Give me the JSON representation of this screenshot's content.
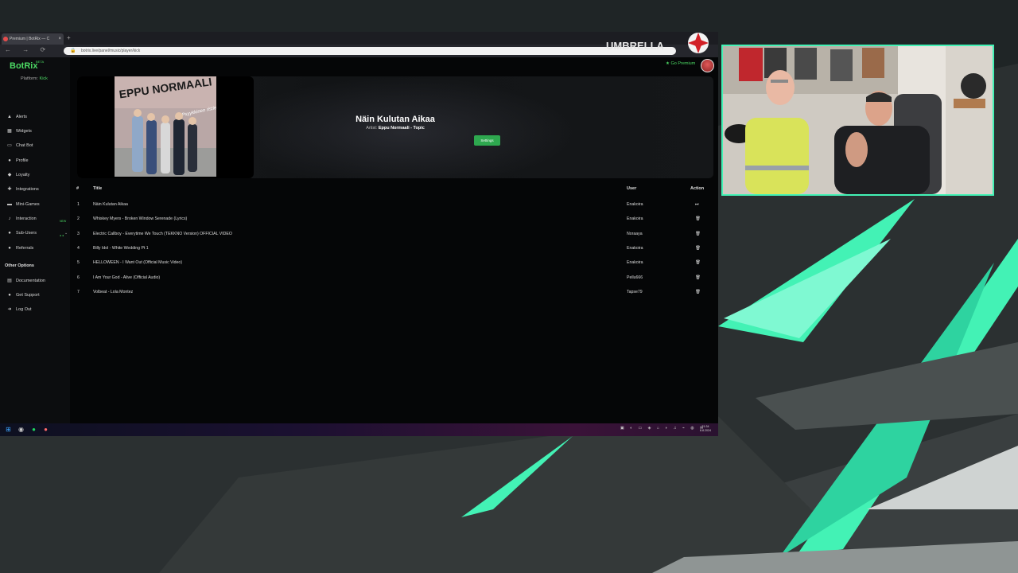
{
  "browser": {
    "tab_title": "Premium | BotRix — C",
    "tab_close": "×",
    "new_tab": "+",
    "nav_buttons": "← → ⟳",
    "url": "botrix.live/panel/music/player/kick"
  },
  "app": {
    "logo": "BotRix",
    "logo_badge": "BETA",
    "platform_label": "Platform:",
    "platform_value": "Kick",
    "go_premium": "★ Go Premium"
  },
  "sidebar": {
    "items": [
      {
        "label": "Alerts",
        "icon": "bell-icon",
        "glyph": "▲"
      },
      {
        "label": "Widgets",
        "icon": "widgets-icon",
        "glyph": "▦"
      },
      {
        "label": "Chat Bot",
        "icon": "chat-icon",
        "glyph": "▭"
      },
      {
        "label": "Profile",
        "icon": "user-icon",
        "glyph": "●"
      },
      {
        "label": "Loyalty",
        "icon": "gift-icon",
        "glyph": "◆"
      },
      {
        "label": "Integrations",
        "icon": "puzzle-icon",
        "glyph": "✚"
      },
      {
        "label": "Mini-Games",
        "icon": "gamepad-icon",
        "glyph": "▬"
      },
      {
        "label": "Interaction",
        "icon": "music-icon",
        "glyph": "♪",
        "badge": "NEW"
      },
      {
        "label": "Sub-Users",
        "icon": "users-icon",
        "glyph": "●",
        "badge": "● ●",
        "chevron": "⌄"
      },
      {
        "label": "Referrals",
        "icon": "people-icon",
        "glyph": "●"
      }
    ],
    "other_options_title": "Other Options",
    "other_items": [
      {
        "label": "Documentation",
        "icon": "book-icon",
        "glyph": "▤"
      },
      {
        "label": "Get Support",
        "icon": "help-icon",
        "glyph": "●"
      },
      {
        "label": "Log Out",
        "icon": "logout-icon",
        "glyph": "➜"
      }
    ]
  },
  "now_playing": {
    "title": "Näin Kulutan Aikaa",
    "artist_label": "Artist:",
    "artist": "Eppu Normaali - Topic",
    "settings_button": "Settings",
    "thumbnail_text": "EPPU NORMAALI",
    "thumbnail_subtext": "Psyykkinen ristieja"
  },
  "queue": {
    "headers": {
      "num": "#",
      "title": "Title",
      "user": "User",
      "action": "Action"
    },
    "rows": [
      {
        "num": "1",
        "title": "Näin Kulutan Aikaa",
        "user": "Enakoira",
        "action": "skip-icon",
        "glyph": "⏭"
      },
      {
        "num": "2",
        "title": "Whiskey Myers - Broken Window Serenade (Lyrics)",
        "user": "Enakoira",
        "action": "trash-icon",
        "glyph": "🗑"
      },
      {
        "num": "3",
        "title": "Electric Callboy - Everytime We Touch (TEKKNO Version) OFFICIAL VIDEO",
        "user": "Noraaya",
        "action": "trash-icon",
        "glyph": "🗑"
      },
      {
        "num": "4",
        "title": "Billy Idol - White Wedding Pt 1",
        "user": "Enakoira",
        "action": "trash-icon",
        "glyph": "🗑"
      },
      {
        "num": "5",
        "title": "HELLOWEEN - I Want Out (Official Music Video)",
        "user": "Enakoira",
        "action": "trash-icon",
        "glyph": "🗑"
      },
      {
        "num": "6",
        "title": "I Am Your God - Alive (Official Audio)",
        "user": "Pellu666",
        "action": "trash-icon",
        "glyph": "🗑"
      },
      {
        "num": "7",
        "title": "Volbeat - Lola Montez",
        "user": "Tapse79",
        "action": "trash-icon",
        "glyph": "🗑"
      }
    ]
  },
  "taskbar": {
    "icons": [
      {
        "name": "windows-start-icon",
        "glyph": "⊞",
        "color": "#3ea6ff"
      },
      {
        "name": "obs-icon",
        "glyph": "◉",
        "color": "#cccccc"
      },
      {
        "name": "spotify-icon",
        "glyph": "●",
        "color": "#1ed760"
      },
      {
        "name": "browser-icon",
        "glyph": "●",
        "color": "#ff6a6a"
      }
    ],
    "tray": "▣ ◐ ▭ ◈ ⌂ ◗ ♫ ⌁ ◍ ✉",
    "time": "21:34",
    "date": "8.8.2024"
  },
  "overlay": {
    "umbrella_logo_text": "UMBRELLA",
    "accent_color": "#43f2b5"
  }
}
